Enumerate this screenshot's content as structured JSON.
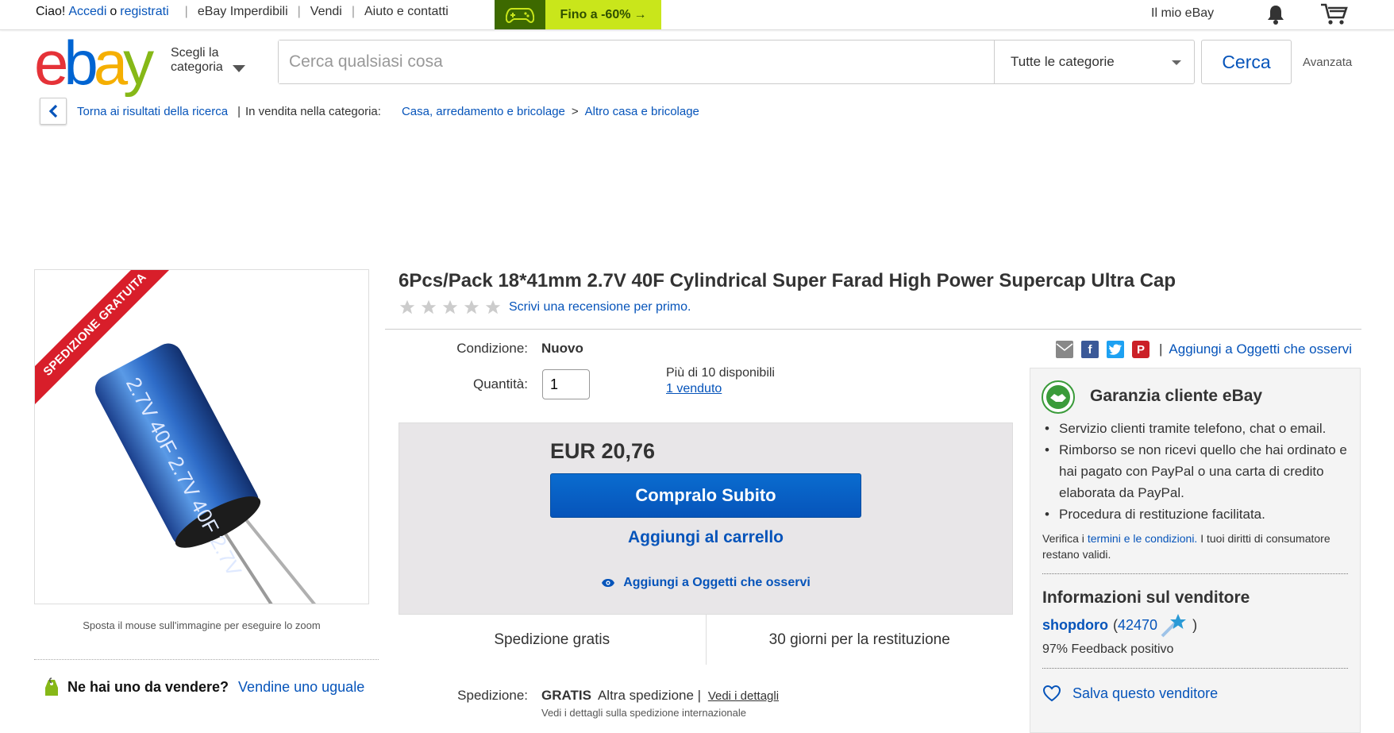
{
  "topbar": {
    "greeting": "Ciao!",
    "signin": "Accedi",
    "or": "o",
    "register": "registrati",
    "links": [
      "eBay Imperdibili",
      "Vendi",
      "Aiuto e contatti"
    ],
    "promo": "Fino a -60%",
    "my_ebay": "Il mio eBay"
  },
  "header": {
    "logo": [
      "e",
      "b",
      "a",
      "y"
    ],
    "logo_colors": [
      "#e53238",
      "#0064d2",
      "#f5af02",
      "#86b817"
    ],
    "category_line1": "Scegli la",
    "category_line2": "categoria",
    "search_placeholder": "Cerca qualsiasi cosa",
    "category_select": "Tutte le categorie",
    "search_button": "Cerca",
    "advanced": "Avanzata"
  },
  "breadcrumb": {
    "back": "Torna ai risultati della ricerca",
    "in_category": "In vendita nella categoria:",
    "cat1": "Casa, arredamento e bricolage",
    "cat2": "Altro casa e bricolage"
  },
  "image": {
    "ribbon": "SPEDIZIONE GRATUITA",
    "zoom_hint": "Sposta il mouse sull'immagine per eseguire lo zoom",
    "capacitor_text": "2.7V 40F 2.7V 40F 2.7V"
  },
  "sell": {
    "question": "Ne hai uno da vendere?",
    "link": "Vendine uno uguale"
  },
  "item": {
    "title": "6Pcs/Pack 18*41mm 2.7V 40F Cylindrical Super Farad High Power Supercap Ultra Cap",
    "review_link": "Scrivi una recensione per primo.",
    "condition_label": "Condizione:",
    "condition": "Nuovo",
    "quantity_label": "Quantità:",
    "quantity": "1",
    "available": "Più di 10 disponibili",
    "sold": "1 venduto"
  },
  "buy": {
    "price": "EUR 20,76",
    "buy_now": "Compralo Subito",
    "add_cart": "Aggiungi al carrello",
    "watch": "Aggiungi a Oggetti che osservi",
    "shipping_free": "Spedizione gratis",
    "returns": "30 giorni per la restituzione"
  },
  "shipping": {
    "label": "Spedizione:",
    "free": "GRATIS",
    "method": "Altra spedizione",
    "details": "Vedi i dettagli",
    "intl": "Vedi i dettagli sulla spedizione internazionale"
  },
  "share": {
    "watch": "Aggiungi a Oggetti che osservi"
  },
  "guarantee": {
    "title": "Garanzia cliente eBay",
    "items": [
      "Servizio clienti tramite telefono, chat o email.",
      "Rimborso se non ricevi quello che hai ordinato e hai pagato con PayPal o una carta di credito elaborata da PayPal.",
      "Procedura di restituzione facilitata."
    ],
    "verify_pre": "Verifica i",
    "verify_link": "termini e le condizioni.",
    "verify_post": "I tuoi diritti di consumatore restano validi."
  },
  "seller": {
    "title": "Informazioni sul venditore",
    "name": "shopdoro",
    "score_open": "(",
    "score": "42470",
    "score_close": ")",
    "feedback": "97% Feedback positivo",
    "save": "Salva questo venditore"
  }
}
